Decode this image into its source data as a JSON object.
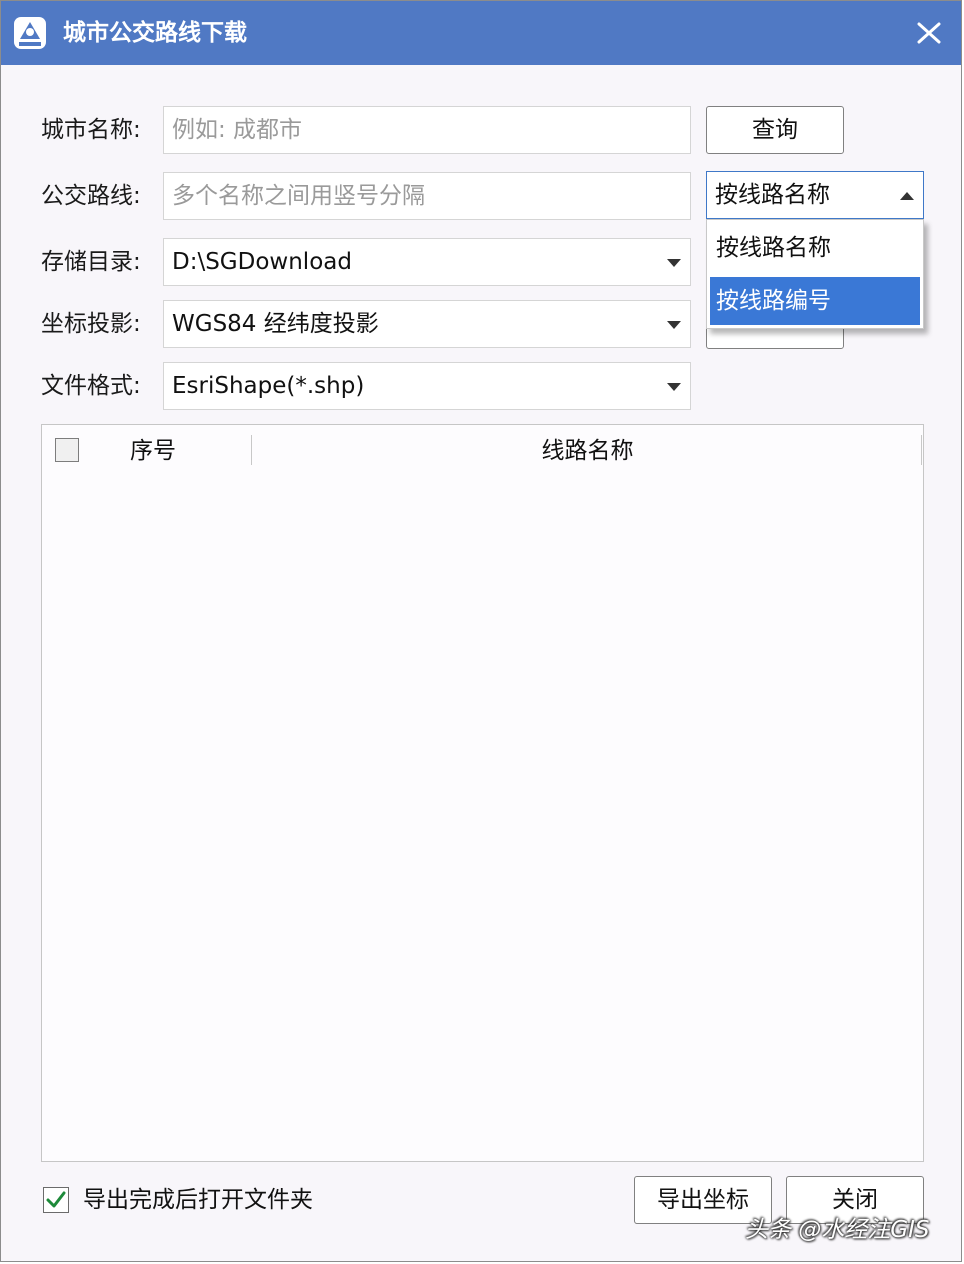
{
  "window": {
    "title": "城市公交路线下载",
    "close_icon": "close-icon",
    "app_icon": "app-logo-icon",
    "accent_color": "#5079c4"
  },
  "form": {
    "city": {
      "label": "城市名称:",
      "placeholder": "例如: 成都市",
      "value": ""
    },
    "query_button": "查询",
    "routes": {
      "label": "公交路线:",
      "placeholder": "多个名称之间用竖号分隔",
      "value": ""
    },
    "search_mode": {
      "selected": "按线路名称",
      "options": [
        "按线路名称",
        "按线路编号"
      ],
      "highlighted": "按线路编号"
    },
    "directory": {
      "label": "存储目录:",
      "value": "D:\\SGDownload"
    },
    "projection": {
      "label": "坐标投影:",
      "value": "WGS84 经纬度投影"
    },
    "format": {
      "label": "文件格式:",
      "value": "EsriShape(*.shp)"
    }
  },
  "route_list": {
    "columns": [
      "序号",
      "线路名称"
    ],
    "rows": []
  },
  "footer": {
    "open_folder_checked": true,
    "open_folder_label": "导出完成后打开文件夹",
    "export_button": "导出坐标",
    "close_button": "关闭"
  },
  "watermark": "头条 @水经注GIS"
}
